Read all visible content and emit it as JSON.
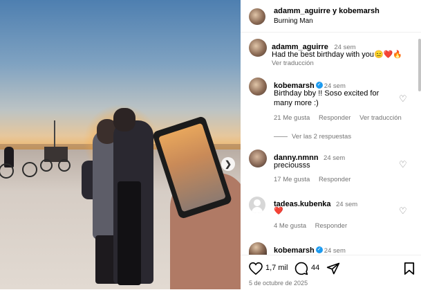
{
  "header": {
    "title": "adamm_aguirre y kobemarsh",
    "location": "Burning Man"
  },
  "caption": {
    "username": "adamm_aguirre",
    "time": "24 sem",
    "text": "Had the best birthday with you",
    "emojis": "😑❤️🔥",
    "translate": "Ver traducción"
  },
  "comments": [
    {
      "username": "kobemarsh",
      "verified": true,
      "time": "24 sem",
      "text_line1": "Birthday bby !! Soso excited for",
      "text_line2": "many more :)",
      "likes": "21 Me gusta",
      "reply": "Responder",
      "translate": "Ver traducción",
      "view_replies": "Ver las 2 respuestas"
    },
    {
      "username": "danny.nmnn",
      "time": "24 sem",
      "text": "preciousss",
      "likes": "17 Me gusta",
      "reply": "Responder"
    },
    {
      "username": "tadeas.kubenka",
      "time": "24 sem",
      "text": "❤️",
      "likes": "4 Me gusta",
      "reply": "Responder"
    },
    {
      "username": "kobemarsh",
      "verified": true,
      "time": "24 sem"
    }
  ],
  "footer": {
    "like_count": "1,7 mil",
    "comment_count": "44",
    "date": "5 de octubre de 2025"
  },
  "icons": {
    "like": "heart-icon",
    "comment": "comment-icon",
    "share": "send-icon",
    "save": "bookmark-icon",
    "next": "chevron-right-icon"
  },
  "colors": {
    "verified": "#1d9bf0",
    "secondary_text": "#737373"
  }
}
